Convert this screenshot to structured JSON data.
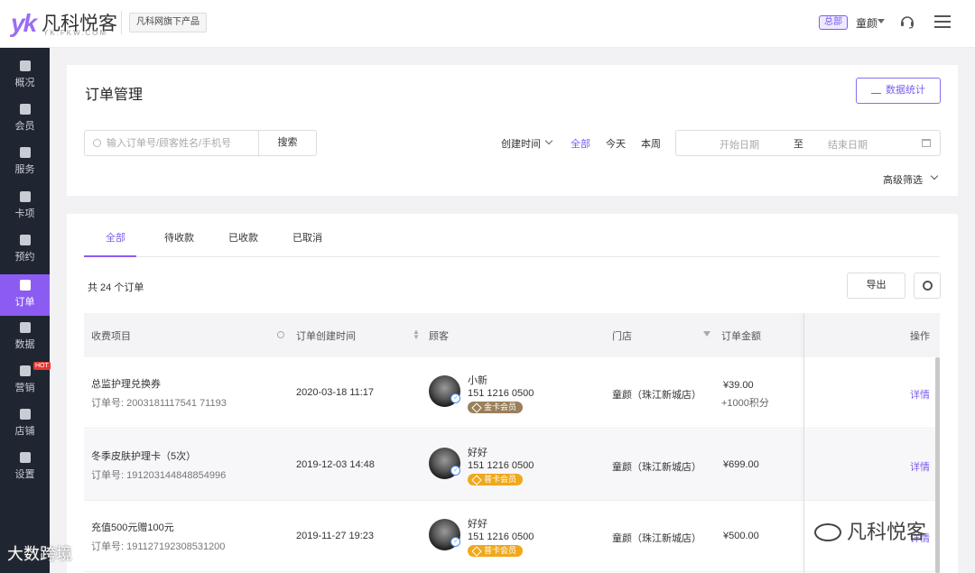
{
  "header": {
    "logo_mark": "yk",
    "logo_text": "凡科悦客",
    "logo_sub": "YK.FKW.COM",
    "product_tag": "凡科网旗下产品",
    "hq_badge": "总部",
    "user_name": "童颜"
  },
  "sidebar": {
    "items": [
      {
        "label": "概况",
        "icon": "monitor-icon"
      },
      {
        "label": "会员",
        "icon": "diamond-icon"
      },
      {
        "label": "服务",
        "icon": "heart-hand-icon"
      },
      {
        "label": "卡项",
        "icon": "card-icon"
      },
      {
        "label": "预约",
        "icon": "calendar-icon"
      },
      {
        "label": "订单",
        "icon": "document-icon",
        "active": true
      },
      {
        "label": "数据",
        "icon": "bar-chart-icon"
      },
      {
        "label": "营销",
        "icon": "megaphone-icon",
        "badge": "HOT"
      },
      {
        "label": "店铺",
        "icon": "store-icon"
      },
      {
        "label": "设置",
        "icon": "gear-icon"
      }
    ]
  },
  "page": {
    "title": "订单管理",
    "stats_button": "数据统计",
    "search_placeholder": "输入订单号/顾客姓名/手机号",
    "search_button": "搜索",
    "time_filter_label": "创建时间",
    "range_options": [
      "全部",
      "今天",
      "本周"
    ],
    "date_start_placeholder": "开始日期",
    "date_separator": "至",
    "date_end_placeholder": "结束日期",
    "advanced_filter": "高级筛选"
  },
  "orders": {
    "tabs": [
      "全部",
      "待收款",
      "已收款",
      "已取消"
    ],
    "count_text": "共 24 个订单",
    "export_button": "导出",
    "columns": [
      "收费项目",
      "订单创建时间",
      "顾客",
      "门店",
      "订单金额",
      "操作"
    ],
    "rows": [
      {
        "item": "总监护理兑换券",
        "order_no": "订单号: 2003181117541 71193",
        "created": "2020-03-18 11:17",
        "customer": "小新",
        "phone": "151 1216 0500",
        "member": "金卡会员",
        "member_type": "gold",
        "store": "童颜（珠江新城店）",
        "amount": "¥39.00",
        "points": "+1000积分",
        "action": "详情"
      },
      {
        "item": "冬季皮肤护理卡（5次）",
        "order_no": "订单号: 191203144848854996",
        "created": "2019-12-03 14:48",
        "customer": "好好",
        "phone": "151 1216 0500",
        "member": "普卡会员",
        "member_type": "normal",
        "store": "童颜（珠江新城店）",
        "amount": "¥699.00",
        "points": "",
        "action": "详情"
      },
      {
        "item": "充值500元赠100元",
        "order_no": "订单号: 191127192308531200",
        "created": "2019-11-27 19:23",
        "customer": "好好",
        "phone": "151 1216 0500",
        "member": "普卡会员",
        "member_type": "normal",
        "store": "童颜（珠江新城店）",
        "amount": "¥500.00",
        "points": "",
        "action": "详情"
      }
    ]
  },
  "watermarks": {
    "left": "大数跨境",
    "right": "凡科悦客"
  },
  "colors": {
    "accent": "#8c5cf2",
    "sidebar_bg": "#1f2631",
    "gold_member": "#9a7f5a",
    "normal_member": "#f0a81d"
  }
}
